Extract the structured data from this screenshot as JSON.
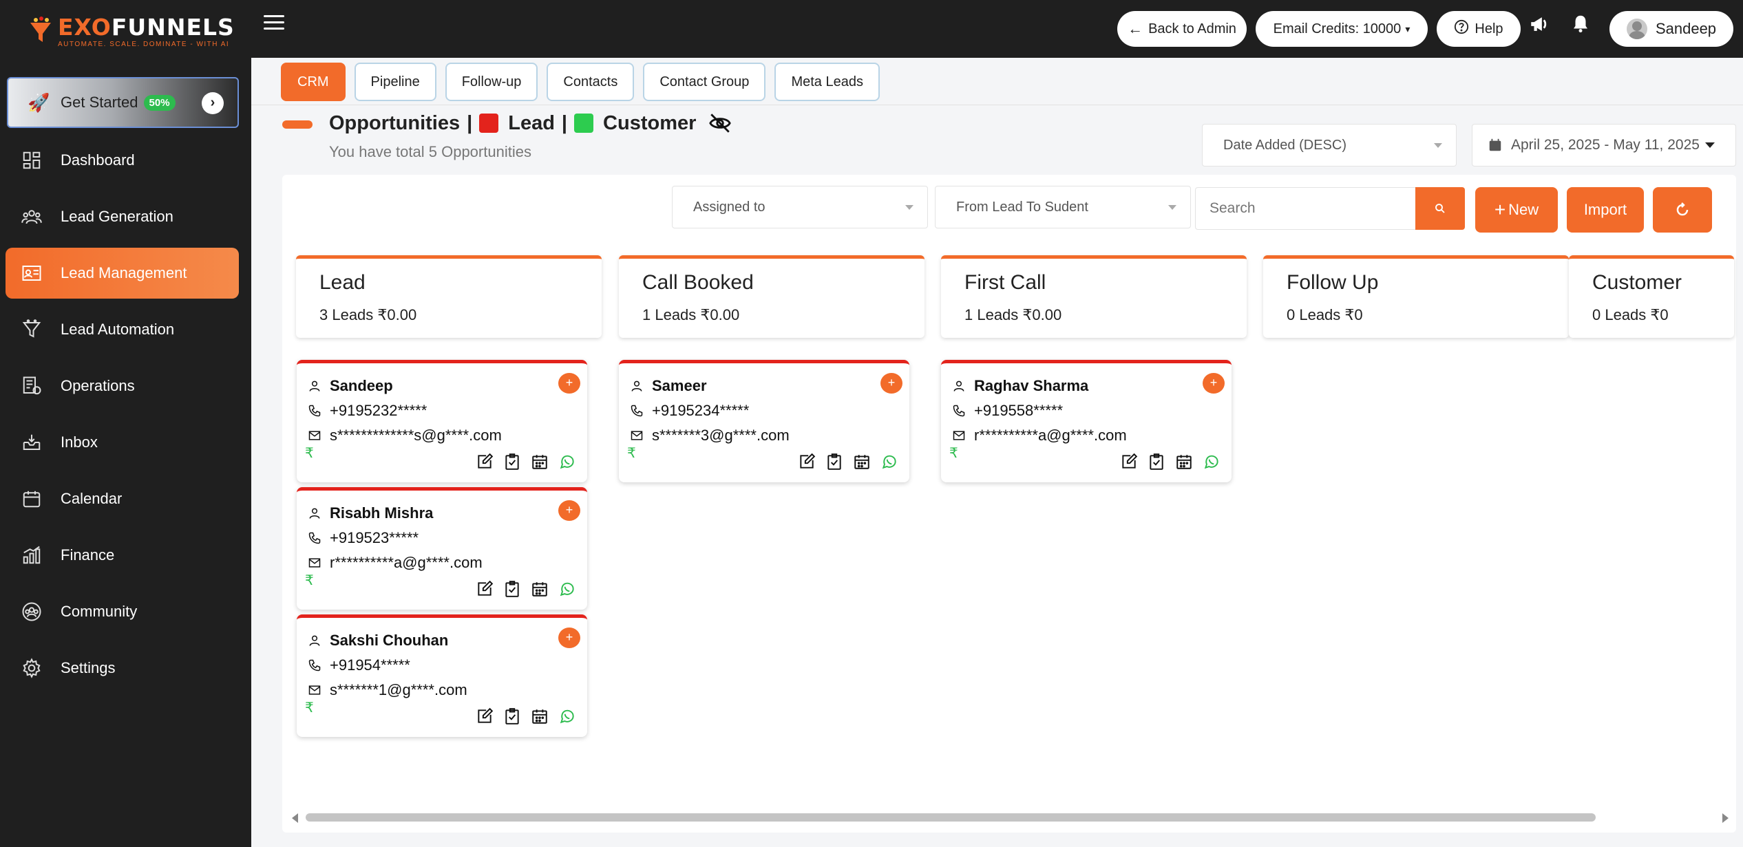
{
  "brand": {
    "name_part1": "EXO",
    "name_part2": "FUNNELS",
    "tagline": "AUTOMATE. SCALE. DOMINATE - WITH AI"
  },
  "sidebar": {
    "get_started": {
      "label": "Get Started",
      "progress": "50%"
    },
    "items": [
      {
        "label": "Dashboard",
        "icon": "dashboard-icon"
      },
      {
        "label": "Lead Generation",
        "icon": "users-icon"
      },
      {
        "label": "Lead Management",
        "icon": "lead-management-icon"
      },
      {
        "label": "Lead Automation",
        "icon": "automation-icon"
      },
      {
        "label": "Operations",
        "icon": "operations-icon"
      },
      {
        "label": "Inbox",
        "icon": "inbox-icon"
      },
      {
        "label": "Calendar",
        "icon": "calendar-icon"
      },
      {
        "label": "Finance",
        "icon": "finance-icon"
      },
      {
        "label": "Community",
        "icon": "community-icon"
      },
      {
        "label": "Settings",
        "icon": "gear-icon"
      }
    ]
  },
  "topbar": {
    "back_label": "Back to Admin",
    "credits_label": "Email Credits: 10000",
    "help_label": "Help",
    "user_name": "Sandeep"
  },
  "tabs": [
    "CRM",
    "Pipeline",
    "Follow-up",
    "Contacts",
    "Contact Group",
    "Meta Leads"
  ],
  "heading": {
    "opportunities": "Opportunities",
    "sep": "|",
    "lead": "Lead",
    "customer": "Customer",
    "total_text": "You have total 5 Opportunities",
    "lead_color": "#e3231c",
    "customer_color": "#2dcc4f"
  },
  "sort": {
    "value": "Date Added (DESC)"
  },
  "date_range": {
    "value": "April 25, 2025 - May 11, 2025"
  },
  "filters": {
    "assigned": "Assigned to",
    "pipeline": "From Lead To Sudent",
    "search_placeholder": "Search",
    "new_label": "New",
    "import_label": "Import"
  },
  "columns": [
    {
      "title": "Lead",
      "summary": "3 Leads ₹0.00"
    },
    {
      "title": "Call Booked",
      "summary": "1 Leads ₹0.00"
    },
    {
      "title": "First Call",
      "summary": "1 Leads ₹0.00"
    },
    {
      "title": "Follow Up",
      "summary": "0 Leads ₹0"
    },
    {
      "title": "Customer",
      "summary": "0 Leads ₹0"
    }
  ],
  "cards": [
    {
      "name": "Sandeep",
      "phone": "+9195232*****",
      "email": "s*************s@g****.com",
      "amount": "₹"
    },
    {
      "name": "Risabh Mishra",
      "phone": "+919523*****",
      "email": "r**********a@g****.com",
      "amount": "₹"
    },
    {
      "name": "Sakshi Chouhan",
      "phone": "+91954*****",
      "email": "s*******1@g****.com",
      "amount": "₹"
    },
    {
      "name": "Sameer",
      "phone": "+9195234*****",
      "email": "s*******3@g****.com",
      "amount": "₹"
    },
    {
      "name": "Raghav Sharma",
      "phone": "+919558*****",
      "email": "r**********a@g****.com",
      "amount": "₹"
    }
  ],
  "colors": {
    "accent": "#f26b2a",
    "sidebar_bg": "#1f1f1f",
    "success": "#2dbb4e",
    "danger": "#e3231c"
  }
}
